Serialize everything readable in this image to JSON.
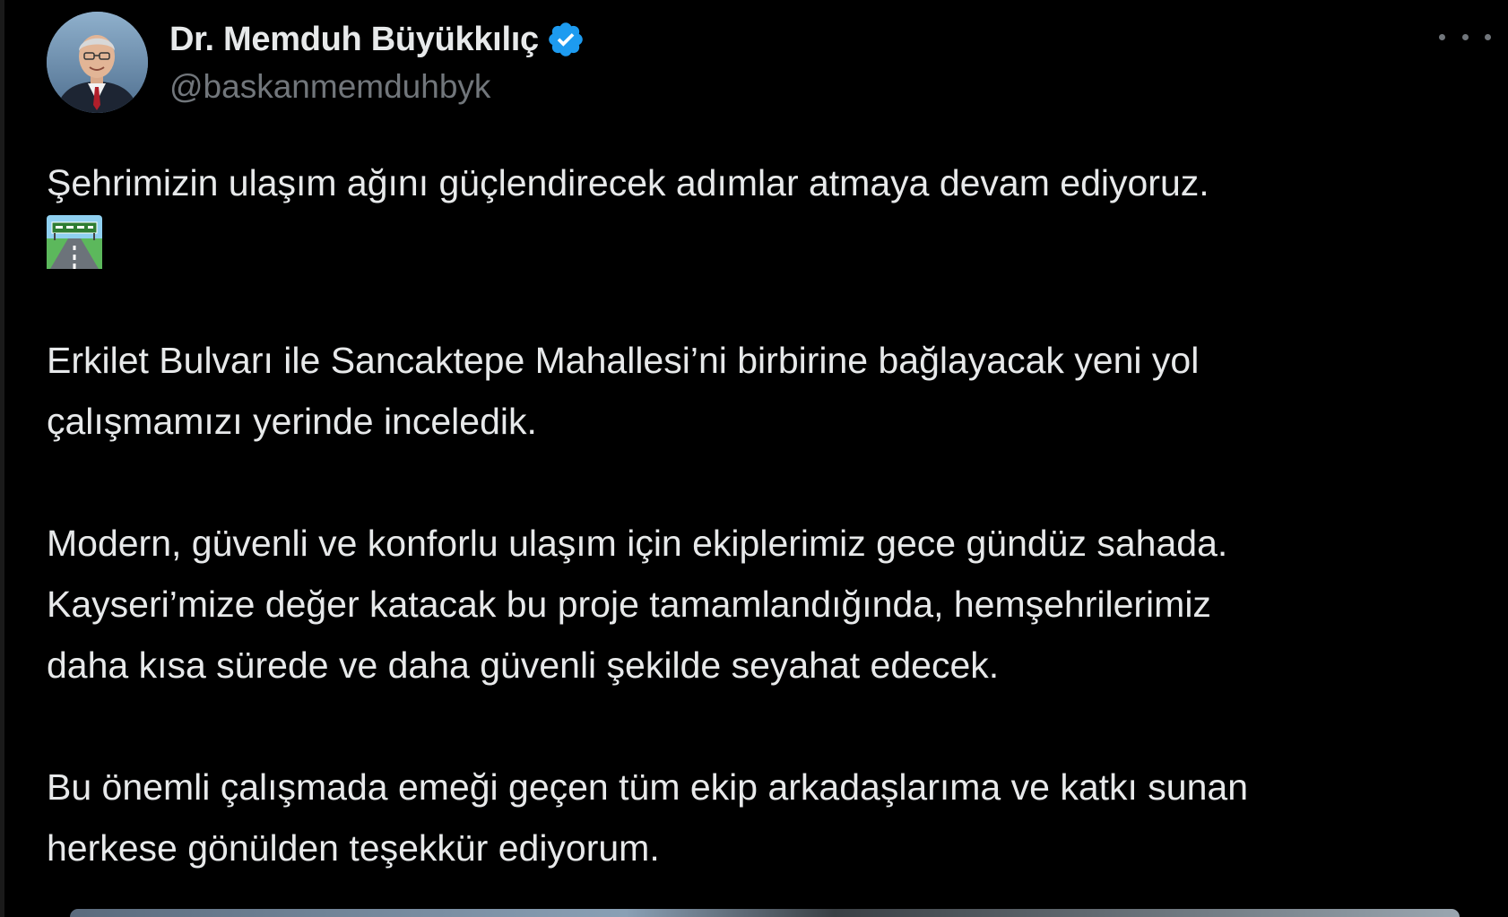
{
  "author": {
    "display_name": "Dr. Memduh Büyükkılıç",
    "handle": "@baskanmemduhbyk",
    "verified": true,
    "verified_color": "#1d9bf0"
  },
  "tweet": {
    "line1": "Şehrimizin ulaşım ağını güçlendirecek adımlar atmaya devam ediyoruz.",
    "emoji": "motorway-emoji",
    "para2_line1": "Erkilet Bulvarı ile Sancaktepe Mahallesi’ni birbirine bağlayacak yeni yol",
    "para2_line2": "çalışmamızı yerinde inceledik.",
    "para3_line1": "Modern, güvenli ve konforlu ulaşım için ekiplerimiz gece gündüz sahada.",
    "para3_line2": "Kayseri’mize değer katacak bu proje tamamlandığında, hemşehrilerimiz",
    "para3_line3": "daha kısa sürede ve daha güvenli şekilde seyahat edecek.",
    "para4_line1": "Bu önemli çalışmada emeği geçen tüm ekip arkadaşlarıma ve katkı sunan",
    "para4_line2": "herkese gönülden teşekkür ediyorum."
  },
  "icons": {
    "more": "more-horizontal-icon",
    "verified": "verified-badge-icon"
  },
  "colors": {
    "background": "#000000",
    "text": "#e7e9ea",
    "secondary": "#71767b"
  }
}
